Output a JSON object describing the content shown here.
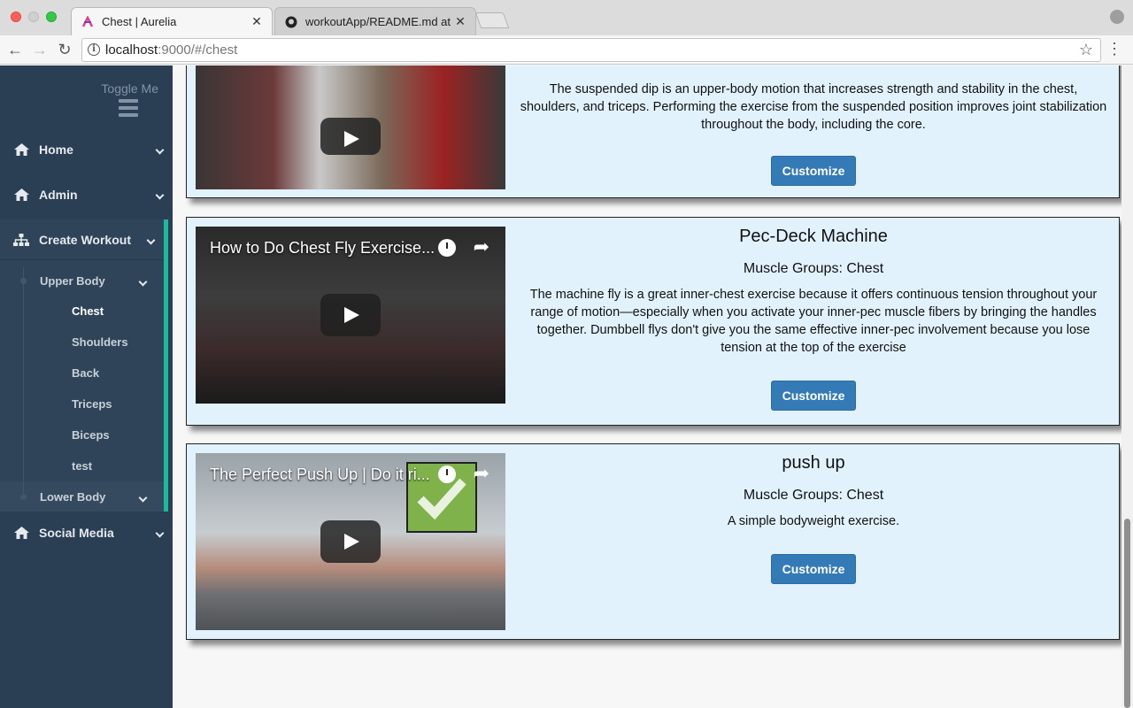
{
  "browser": {
    "tabs": [
      {
        "title": "Chest | Aurelia",
        "favicon": "aurelia-icon",
        "active": true
      },
      {
        "title": "workoutApp/README.md at m",
        "favicon": "github-icon",
        "active": false
      }
    ],
    "url_host": "localhost",
    "url_rest": ":9000/#/chest"
  },
  "sidebar": {
    "toggle_label": "Toggle Me",
    "items": [
      {
        "label": "Home",
        "icon": "home-icon"
      },
      {
        "label": "Admin",
        "icon": "home-icon"
      },
      {
        "label": "Create Workout",
        "icon": "sitemap-icon"
      },
      {
        "label": "Social Media",
        "icon": "home-icon"
      }
    ],
    "upper_body": "Upper Body",
    "lower_body": "Lower Body",
    "sub_items": [
      "Chest",
      "Shoulders",
      "Back",
      "Triceps",
      "Biceps",
      "test"
    ],
    "accent_color": "#1abb9c"
  },
  "exercises": [
    {
      "name": "",
      "video_title": "",
      "muscles": "",
      "description": "The suspended dip is an upper-body motion that increases strength and stability in the chest, shoulders, and triceps. Performing the exercise from the suspended position improves joint stabilization throughout the body, including the core.",
      "button": "Customize"
    },
    {
      "name": "Pec-Deck Machine",
      "video_title": "How to Do Chest Fly Exercise...",
      "muscles": "Muscle Groups: Chest",
      "description": "The machine fly is a great inner-chest exercise because it offers continuous tension throughout your range of motion—especially when you activate your inner-pec muscle fibers by bringing the handles together. Dumbbell flys don't give you the same effective inner-pec involvement because you lose tension at the top of the exercise",
      "button": "Customize"
    },
    {
      "name": "push up",
      "video_title": "The Perfect Push Up | Do it ri...",
      "muscles": "Muscle Groups: Chest",
      "description": "A simple bodyweight exercise.",
      "button": "Customize"
    }
  ],
  "colors": {
    "card_bg": "#e1f2fd",
    "button_bg": "#337ab7",
    "sidebar_bg": "#2a3f54"
  }
}
